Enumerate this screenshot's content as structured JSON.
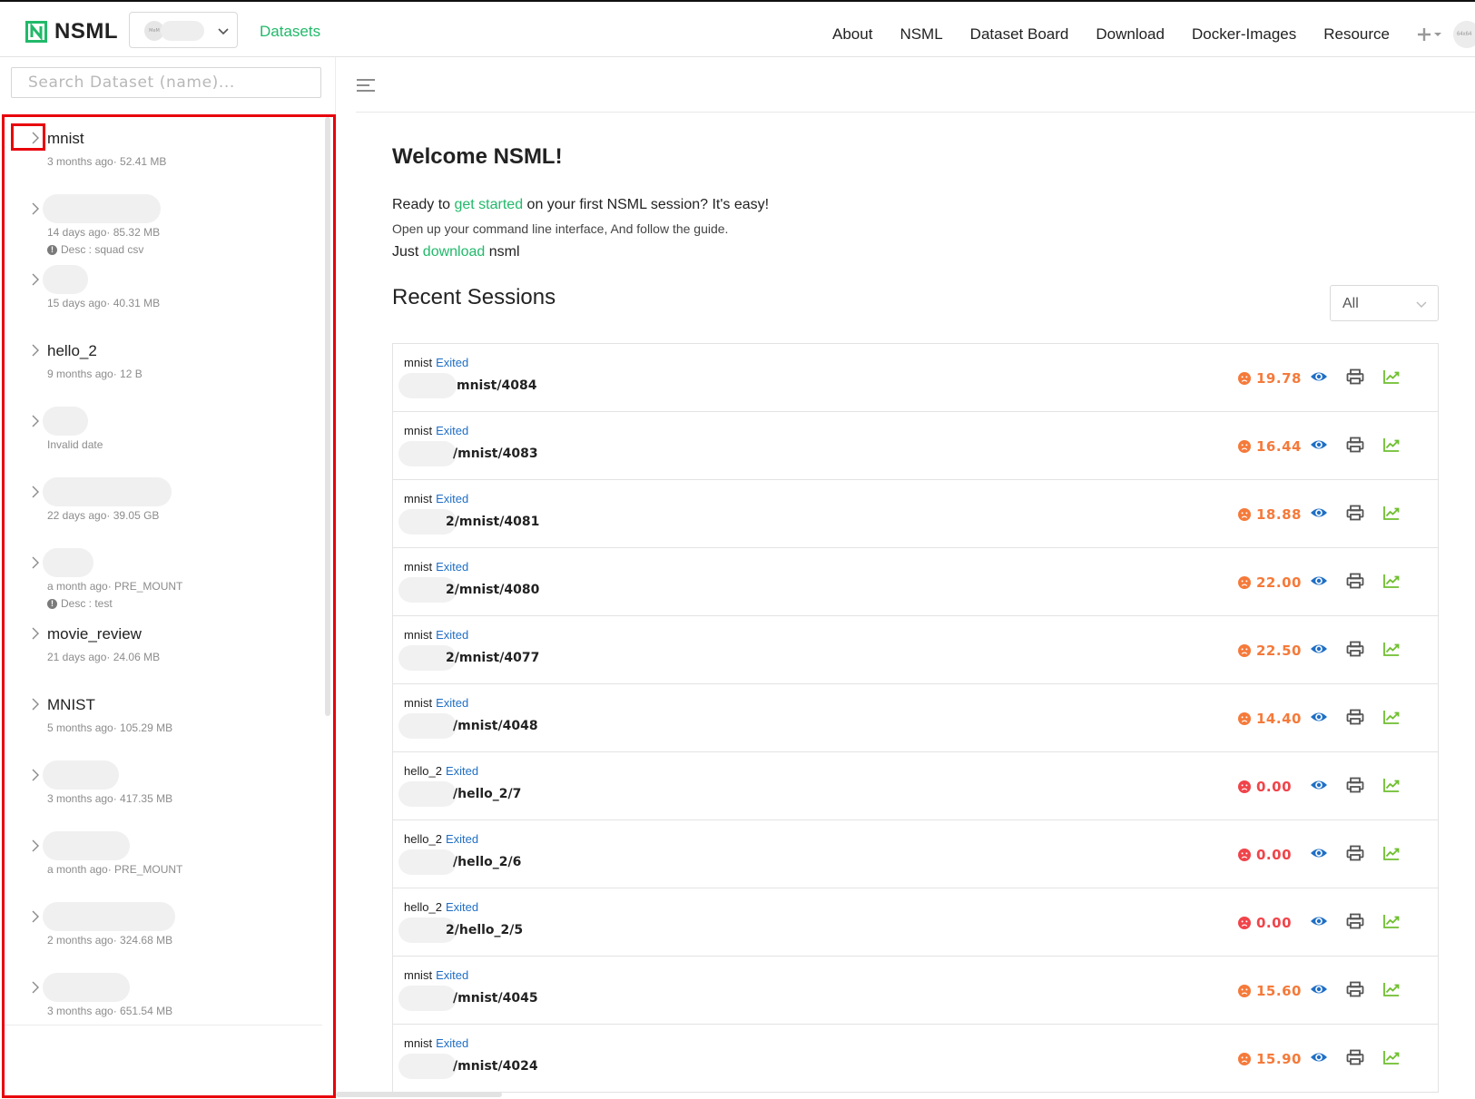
{
  "header": {
    "logo_text": "NSML",
    "org_avatar_text": "MeM",
    "datasets_label": "Datasets",
    "menu": [
      "About",
      "NSML",
      "Dataset Board",
      "Download",
      "Docker-Images",
      "Resource"
    ],
    "user_avatar_text": "64x64",
    "accent_color": "#21b96a"
  },
  "sidebar": {
    "search_placeholder": "Search Dataset (name)...",
    "datasets": [
      {
        "name": "mnist",
        "meta": "3 months ago· 52.41 MB",
        "desc": ""
      },
      {
        "name": "",
        "meta": "14 days ago· 85.32 MB",
        "desc": "Desc   : squad csv"
      },
      {
        "name": "",
        "meta": "15 days ago· 40.31 MB",
        "desc": ""
      },
      {
        "name": "hello_2",
        "meta": "9 months ago· 12 B",
        "desc": ""
      },
      {
        "name": "",
        "meta": "Invalid date",
        "desc": ""
      },
      {
        "name": "",
        "meta": "22 days ago· 39.05 GB",
        "desc": ""
      },
      {
        "name": "",
        "meta": "a month ago· PRE_MOUNT",
        "desc": "Desc   : test"
      },
      {
        "name": "movie_review",
        "meta": "21 days ago· 24.06 MB",
        "desc": ""
      },
      {
        "name": "MNIST",
        "meta": "5 months ago· 105.29 MB",
        "desc": ""
      },
      {
        "name": "",
        "meta": "3 months ago· 417.35 MB",
        "desc": ""
      },
      {
        "name": "",
        "meta": "a month ago· PRE_MOUNT",
        "desc": ""
      },
      {
        "name": "",
        "meta": "2 months ago· 324.68 MB",
        "desc": ""
      },
      {
        "name": "",
        "meta": "3 months ago· 651.54 MB",
        "desc": ""
      }
    ]
  },
  "main": {
    "welcome_title": "Welcome NSML!",
    "line1_pre": "Ready to ",
    "line1_link": "get started",
    "line1_post": " on your first NSML session? It's easy!",
    "line2": "Open up your command line interface, And follow the guide.",
    "line3_pre": "Just ",
    "line3_link": "download",
    "line3_post": " nsml",
    "recent_title": "Recent Sessions",
    "filter_value": "All",
    "sessions": [
      {
        "dataset": "mnist",
        "status": "Exited",
        "path": "mnist/4084",
        "score": "19.78",
        "mood": "orange"
      },
      {
        "dataset": "mnist",
        "status": "Exited",
        "path": "/mnist/4083",
        "score": "16.44",
        "mood": "orange"
      },
      {
        "dataset": "mnist",
        "status": "Exited",
        "path": "2/mnist/4081",
        "score": "18.88",
        "mood": "orange"
      },
      {
        "dataset": "mnist",
        "status": "Exited",
        "path": "2/mnist/4080",
        "score": "22.00",
        "mood": "orange"
      },
      {
        "dataset": "mnist",
        "status": "Exited",
        "path": "2/mnist/4077",
        "score": "22.50",
        "mood": "orange"
      },
      {
        "dataset": "mnist",
        "status": "Exited",
        "path": "/mnist/4048",
        "score": "14.40",
        "mood": "orange"
      },
      {
        "dataset": "hello_2",
        "status": "Exited",
        "path": "/hello_2/7",
        "score": "0.00",
        "mood": "red"
      },
      {
        "dataset": "hello_2",
        "status": "Exited",
        "path": "/hello_2/6",
        "score": "0.00",
        "mood": "red"
      },
      {
        "dataset": "hello_2",
        "status": "Exited",
        "path": "2/hello_2/5",
        "score": "0.00",
        "mood": "red"
      },
      {
        "dataset": "mnist",
        "status": "Exited",
        "path": "/mnist/4045",
        "score": "15.60",
        "mood": "orange"
      },
      {
        "dataset": "mnist",
        "status": "Exited",
        "path": "/mnist/4024",
        "score": "15.90",
        "mood": "orange"
      }
    ],
    "colors": {
      "orange": "#f57a3a",
      "red": "#f0444a",
      "eye": "#1f6fc5",
      "print": "#555555",
      "chart": "#6fbf2f",
      "status": "#1f6fc5"
    }
  }
}
